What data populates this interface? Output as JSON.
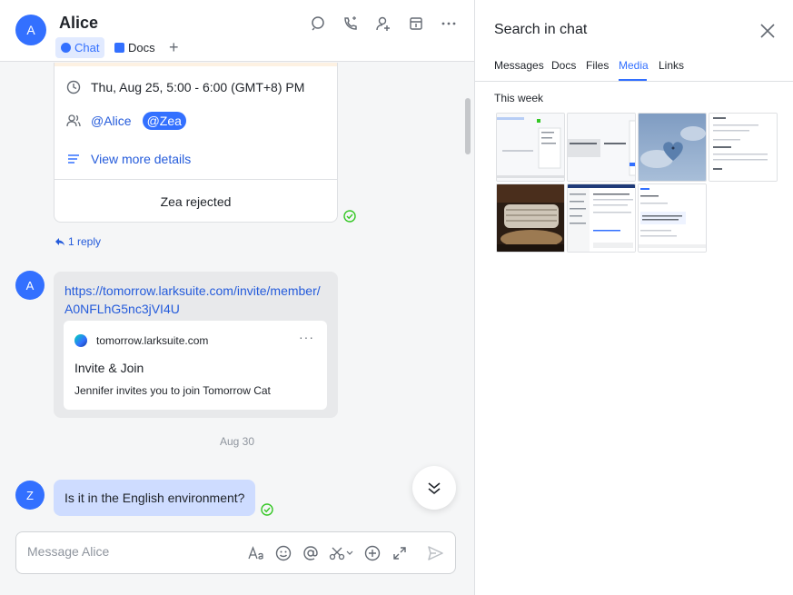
{
  "header": {
    "avatar_letter": "A",
    "title": "Alice",
    "tabs": [
      {
        "label": "Chat"
      },
      {
        "label": "Docs"
      }
    ],
    "add_tab": "+",
    "icons": [
      "search-icon",
      "phone-icon",
      "add-member-icon",
      "calendar-icon",
      "more-icon"
    ]
  },
  "event_card": {
    "time": "Thu, Aug 25, 5:00 - 6:00 (GMT+8) PM",
    "attendees": [
      "@Alice",
      "@Zea"
    ],
    "view_more": "View more details",
    "status": "Zea rejected"
  },
  "reply": {
    "label": "1 reply"
  },
  "link_message": {
    "avatar_letter": "A",
    "url": "https://tomorrow.larksuite.com/invite/member/A0NFLhG5nc3jVI4U",
    "preview": {
      "site": "tomorrow.larksuite.com",
      "title": "Invite & Join",
      "description": "Jennifer invites you to join Tomorrow Cat",
      "more": "···"
    }
  },
  "date_divider": "Aug 30",
  "question_message": {
    "avatar_letter": "Z",
    "text": "Is it in the English environment?"
  },
  "composer": {
    "placeholder": "Message Alice"
  },
  "search_panel": {
    "title": "Search in chat",
    "tabs": [
      "Messages",
      "Docs",
      "Files",
      "Media",
      "Links"
    ],
    "active_tab": "Media",
    "section_label": "This week",
    "media_count": 7
  },
  "colors": {
    "accent": "#3370ff",
    "link": "#245bdb",
    "own_bubble": "#cedcff",
    "other_bubble": "#e8e9eb",
    "read_check": "#34c724"
  }
}
